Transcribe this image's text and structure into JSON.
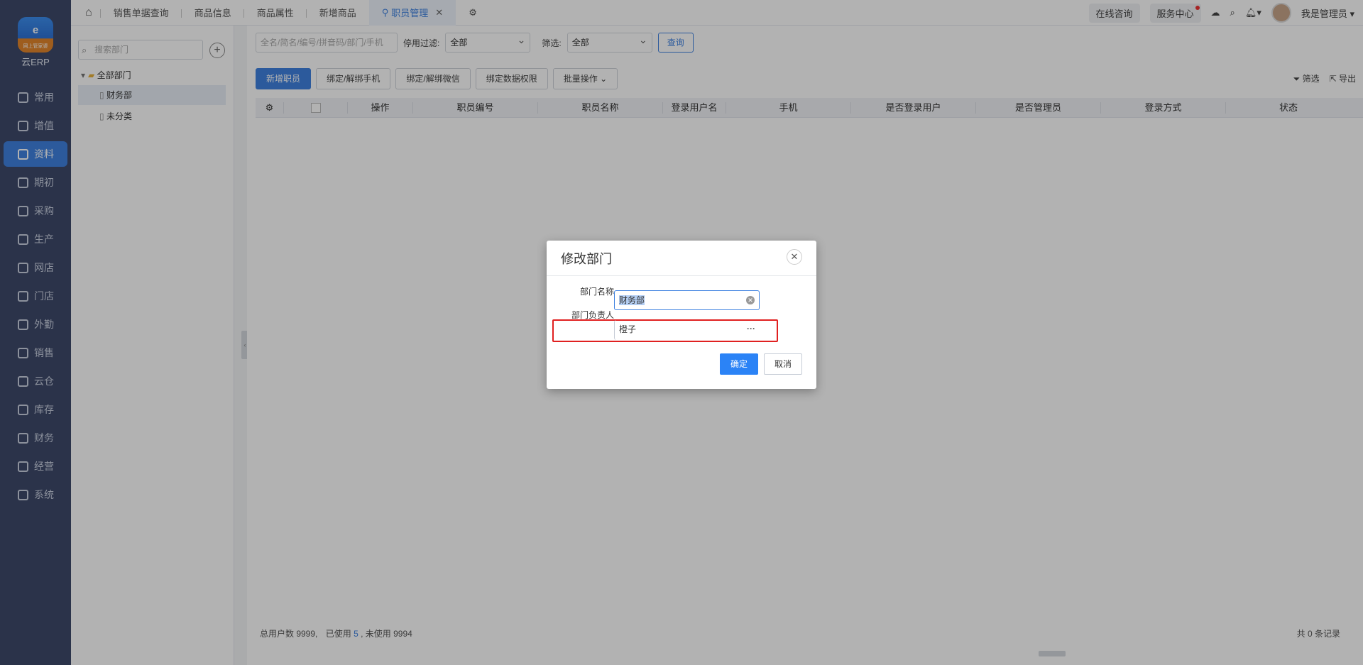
{
  "app": {
    "logo_badge": "网上管家婆",
    "logo_text": "云ERP"
  },
  "sidebar": {
    "items": [
      {
        "label": "常用",
        "icon": "star-icon"
      },
      {
        "label": "增值",
        "icon": "plus-square-icon"
      },
      {
        "label": "资料",
        "icon": "document-icon",
        "active": true
      },
      {
        "label": "期初",
        "icon": "target-icon"
      },
      {
        "label": "采购",
        "icon": "cart-icon"
      },
      {
        "label": "生产",
        "icon": "factory-icon"
      },
      {
        "label": "网店",
        "icon": "shop-icon"
      },
      {
        "label": "门店",
        "icon": "store-icon"
      },
      {
        "label": "外勤",
        "icon": "compass-icon"
      },
      {
        "label": "销售",
        "icon": "bar-chart-icon"
      },
      {
        "label": "云仓",
        "icon": "warehouse-icon"
      },
      {
        "label": "库存",
        "icon": "inventory-icon"
      },
      {
        "label": "财务",
        "icon": "wallet-icon"
      },
      {
        "label": "经营",
        "icon": "trend-icon"
      },
      {
        "label": "系统",
        "icon": "gear-icon"
      }
    ]
  },
  "tabs": [
    {
      "label": "销售单据查询"
    },
    {
      "label": "商品信息"
    },
    {
      "label": "商品属性"
    },
    {
      "label": "新增商品"
    },
    {
      "label": "职员管理",
      "active": true
    }
  ],
  "topright": {
    "consult": "在线咨询",
    "service": "服务中心",
    "user": "我是管理员"
  },
  "dept": {
    "search_placeholder": "搜索部门",
    "tree": [
      {
        "label": "全部部门",
        "level": 0
      },
      {
        "label": "财务部",
        "level": 1,
        "selected": true
      },
      {
        "label": "未分类",
        "level": 1
      }
    ]
  },
  "filter": {
    "search_placeholder": "全名/简名/编号/拼音码/部门/手机",
    "disable_label": "停用过滤:",
    "disable_value": "全部",
    "filter_label": "筛选:",
    "filter_value": "全部",
    "query_label": "查询"
  },
  "actions": {
    "add": "新增职员",
    "bind_phone": "绑定/解绑手机",
    "bind_wechat": "绑定/解绑微信",
    "bind_data": "绑定数据权限",
    "batch": "批量操作",
    "filter_tool": "筛选",
    "export_tool": "导出"
  },
  "table": {
    "columns": [
      "操作",
      "职员编号",
      "职员名称",
      "登录用户名",
      "手机",
      "是否登录用户",
      "是否管理员",
      "登录方式",
      "状态"
    ]
  },
  "footer": {
    "total_label": "总用户数 9999,",
    "used_label": "已使用",
    "used_value": "5",
    "unused_label": ", 未使用 9994",
    "records": "共 0 条记录"
  },
  "dialog": {
    "title": "修改部门",
    "name_label": "部门名称",
    "name_value": "财务部",
    "manager_label": "部门负责人",
    "manager_value": "橙子",
    "ok": "确定",
    "cancel": "取消"
  }
}
